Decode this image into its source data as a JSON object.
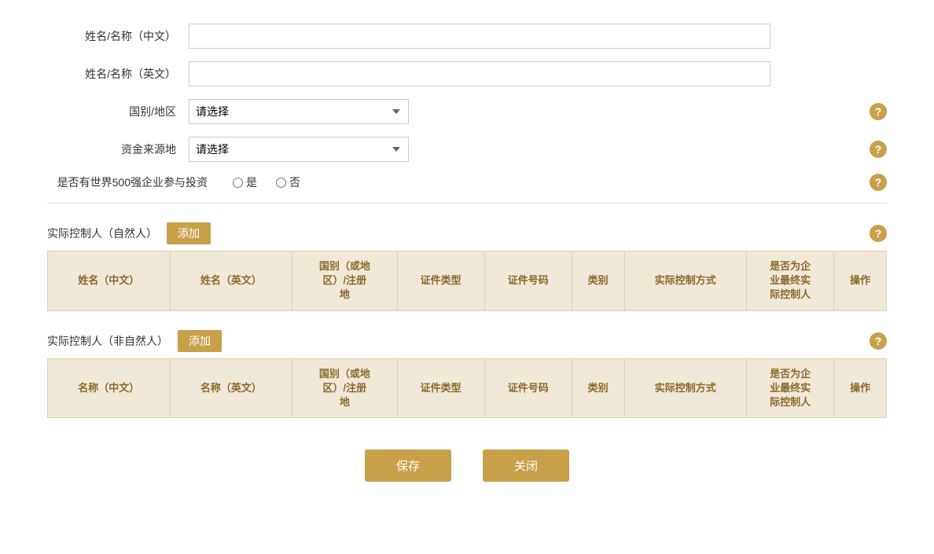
{
  "form": {
    "name_cn_label": "姓名/名称（中文）",
    "name_en_label": "姓名/名称（英文）",
    "country_label": "国别/地区",
    "country_placeholder": "请选择",
    "fund_source_label": "资金来源地",
    "fund_source_placeholder": "请选择",
    "fortune500_label": "是否有世界500强企业参与投资",
    "fortune500_yes": "是",
    "fortune500_no": "否",
    "name_cn_value": "",
    "name_en_value": ""
  },
  "section_natural": {
    "title": "实际控制人（自然人）",
    "add_label": "添加",
    "columns": [
      "姓名（中文）",
      "姓名（英文）",
      "国别（或地\n区）/注册\n地",
      "证件类型",
      "证件号码",
      "类别",
      "实际控制方式",
      "是否为企\n业最终实\n际控制人",
      "操作"
    ]
  },
  "section_non_natural": {
    "title": "实际控制人（非自然人）",
    "add_label": "添加",
    "columns": [
      "名称（中文）",
      "名称（英文）",
      "国别（或地\n区）/注册\n地",
      "证件类型",
      "证件号码",
      "类别",
      "实际控制方式",
      "是否为企\n业最终实\n际控制人",
      "操作"
    ]
  },
  "footer": {
    "save_label": "保存",
    "close_label": "关闭"
  },
  "help_icon_label": "?",
  "icons": {
    "dropdown_arrow": "▾"
  }
}
